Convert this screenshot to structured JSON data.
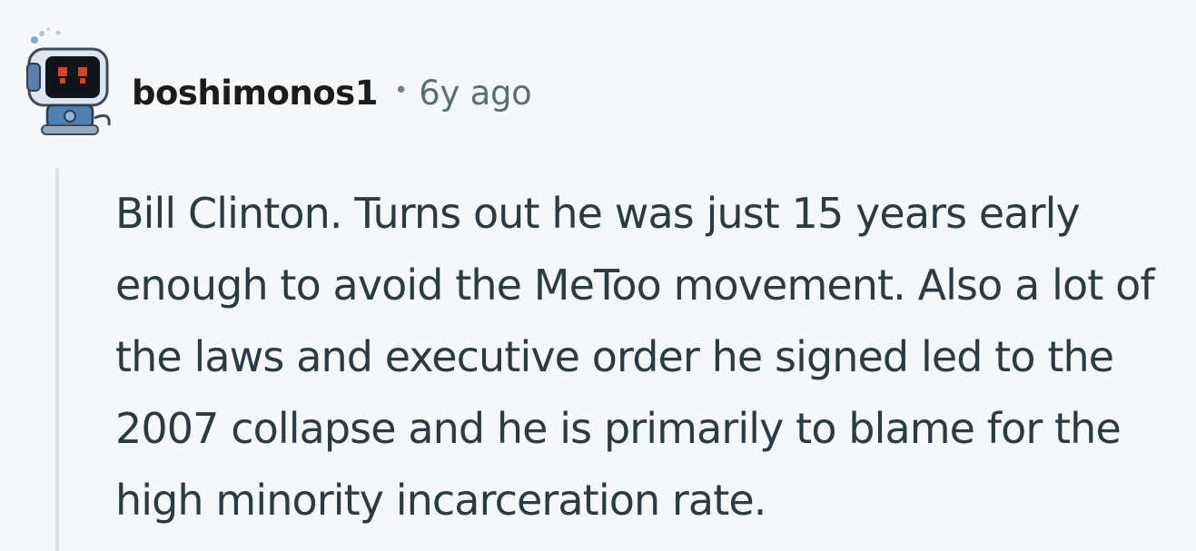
{
  "comment": {
    "author": "boshimonos1",
    "separator": "•",
    "timestamp": "6y ago",
    "avatar_icon": "robot-avatar-icon",
    "body": "Bill Clinton. Turns out he was just 15 years early enough to avoid the MeToo movement. Also a lot of the laws and executive order he signed led to the 2007 collapse and he is primarily to blame for the high minority incarceration rate."
  },
  "colors": {
    "background": "#f6f7f8",
    "author": "#1c1c1c",
    "timestamp": "#576f76",
    "body_text": "#2a3c42",
    "thread_line": "#dfe3e6"
  }
}
